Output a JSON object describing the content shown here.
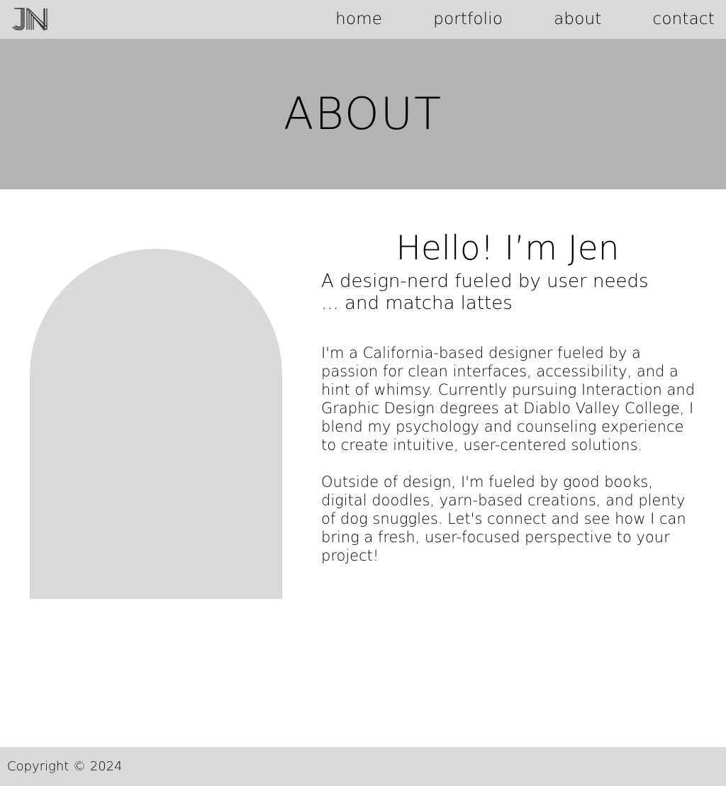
{
  "nav": {
    "logo_icon": "jn-monogram-icon",
    "links": [
      {
        "label": "home"
      },
      {
        "label": "portfolio"
      },
      {
        "label": "about"
      },
      {
        "label": "contact"
      }
    ]
  },
  "hero": {
    "title": "ABOUT"
  },
  "about": {
    "greeting": "Hello! I’m Jen",
    "tagline_line1": "A design-nerd fueled by user needs",
    "tagline_line2": "... and matcha lattes",
    "bio_paragraph_1": "I'm a California-based designer fueled by a passion for clean interfaces, accessibility, and a hint of whimsy. Currently pursuing Interaction and Graphic Design degrees at Diablo Valley College, I blend my psychology and counseling experience to create intuitive, user-centered solutions.",
    "bio_paragraph_2": "Outside of design, I'm fueled by good books, digital doodles, yarn-based creations, and plenty of dog snuggles. Let's connect and see how I can bring a fresh, user-focused perspective to your project!"
  },
  "footer": {
    "copyright": "Copyright © 2024"
  },
  "colors": {
    "nav_bg": "#d9d9d9",
    "hero_bg": "#b3b3b3",
    "photo_placeholder": "#d9d9d9",
    "footer_bg": "#d9d9d9",
    "text": "#000000"
  }
}
